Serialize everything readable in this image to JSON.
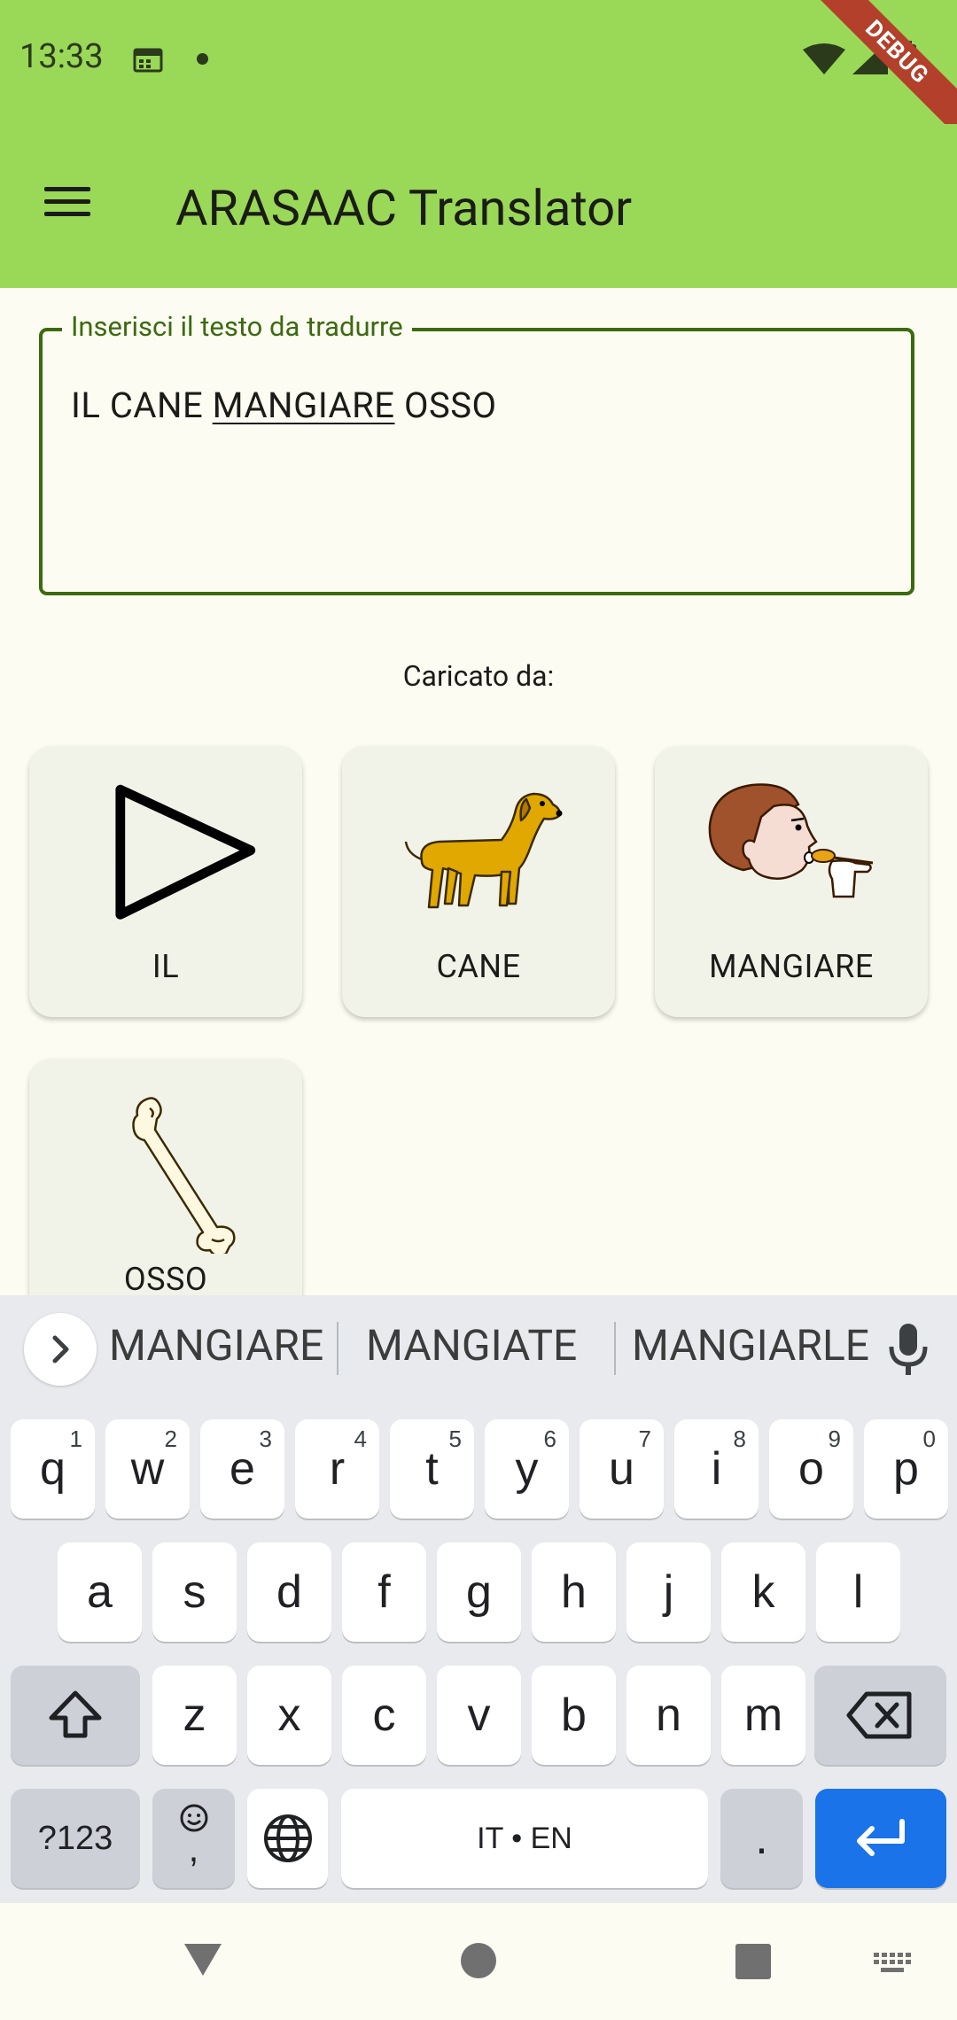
{
  "status": {
    "time": "13:33",
    "debug_label": "DEBUG"
  },
  "app_bar": {
    "title": "ARASAAC Translator"
  },
  "input": {
    "label": "Inserisci il testo da tradurre",
    "text_before": "IL CANE ",
    "text_underlined": "MANGIARE",
    "text_after": " OSSO"
  },
  "loaded_by": "Caricato da:",
  "pictograms": [
    {
      "label": "IL",
      "icon": "triangle-play-icon"
    },
    {
      "label": "CANE",
      "icon": "dog-icon"
    },
    {
      "label": "MANGIARE",
      "icon": "person-eating-icon"
    },
    {
      "label": "OSSO",
      "icon": "bone-icon"
    }
  ],
  "keyboard": {
    "suggestions": [
      "MANGIARE",
      "MANGIATE",
      "MANGIARLE"
    ],
    "row1": [
      {
        "key": "q",
        "hint": "1"
      },
      {
        "key": "w",
        "hint": "2"
      },
      {
        "key": "e",
        "hint": "3"
      },
      {
        "key": "r",
        "hint": "4"
      },
      {
        "key": "t",
        "hint": "5"
      },
      {
        "key": "y",
        "hint": "6"
      },
      {
        "key": "u",
        "hint": "7"
      },
      {
        "key": "i",
        "hint": "8"
      },
      {
        "key": "o",
        "hint": "9"
      },
      {
        "key": "p",
        "hint": "0"
      }
    ],
    "row2": [
      "a",
      "s",
      "d",
      "f",
      "g",
      "h",
      "j",
      "k",
      "l"
    ],
    "row3": [
      "z",
      "x",
      "c",
      "v",
      "b",
      "n",
      "m"
    ],
    "symbols_label": "?123",
    "comma_label": ",",
    "space_label": "IT • EN",
    "period_label": ".",
    "accent_color": "#1A73E8"
  },
  "colors": {
    "app_bar": "#9AD858",
    "primary": "#3C6A10",
    "background": "#FCFCF2",
    "card": "#F2F3E8"
  }
}
